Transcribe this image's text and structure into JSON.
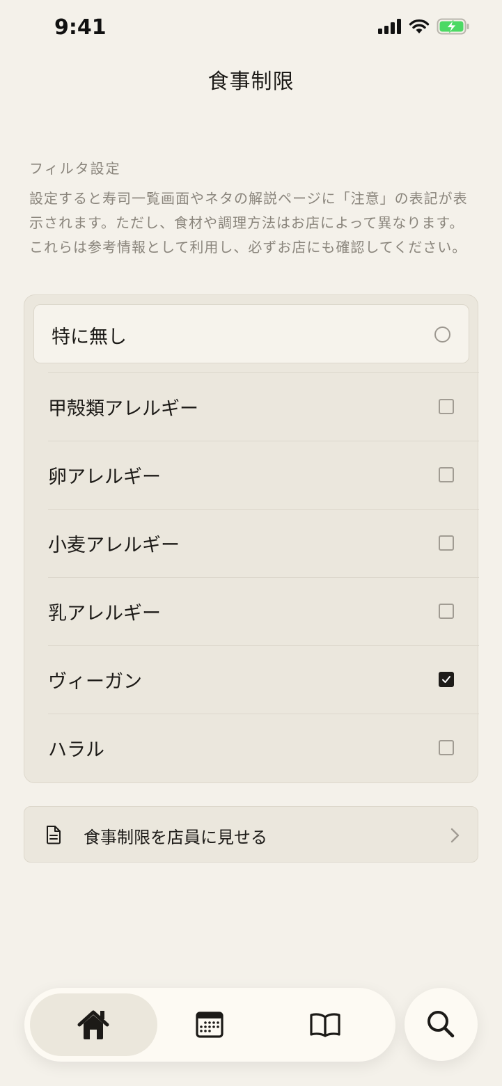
{
  "status_bar": {
    "time": "9:41",
    "icons": [
      "cellular-signal-icon",
      "wifi-icon",
      "battery-charging-icon"
    ],
    "battery_color": "#4cd964"
  },
  "header": {
    "title": "食事制限"
  },
  "filter_section": {
    "label": "フィルタ設定",
    "description": "設定すると寿司一覧画面やネタの解説ページに「注意」の表記が表示されます。ただし、食材や調理方法はお店によって異なります。これらは参考情報として利用し、必ずお店にも確認してください。"
  },
  "options": {
    "none": {
      "label": "特に無し",
      "selected": false
    },
    "items": [
      {
        "label": "甲殻類アレルギー",
        "checked": false
      },
      {
        "label": "卵アレルギー",
        "checked": false
      },
      {
        "label": "小麦アレルギー",
        "checked": false
      },
      {
        "label": "乳アレルギー",
        "checked": false
      },
      {
        "label": "ヴィーガン",
        "checked": true
      },
      {
        "label": "ハラル",
        "checked": false
      }
    ]
  },
  "show_staff": {
    "label": "食事制限を店員に見せる",
    "icon": "document-icon"
  },
  "tab_bar": {
    "tabs": [
      {
        "icon": "home-icon",
        "active": true
      },
      {
        "icon": "calendar-icon",
        "active": false
      },
      {
        "icon": "book-icon",
        "active": false
      }
    ],
    "search_icon": "search-icon"
  }
}
